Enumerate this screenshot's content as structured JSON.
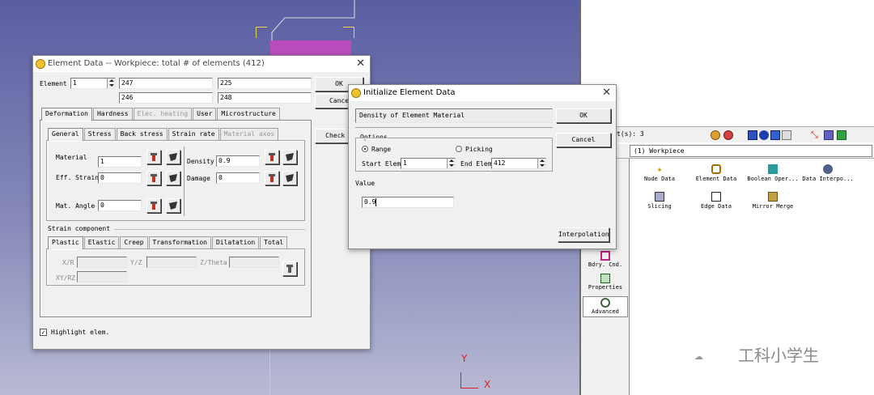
{
  "viewport": {
    "axis_y": "Y",
    "axis_x": "X"
  },
  "element_dialog": {
    "title": "Element Data -- Workpiece: total # of elements (412)",
    "element_label": "Element",
    "element_value": "1",
    "neighbors": [
      "247",
      "225",
      "246",
      "248"
    ],
    "ok_label": "OK",
    "cancel_label": "Cance",
    "check_label": "Check M",
    "main_tabs": [
      "Deformation",
      "Hardness",
      "Elec. heating",
      "User",
      "Microstructure"
    ],
    "sub_tabs": [
      "General",
      "Stress",
      "Back stress",
      "Strain rate",
      "Material axes"
    ],
    "material_label": "Material",
    "material_value": "1",
    "eff_strain_label": "Eff. Strain",
    "eff_strain_value": "0",
    "density_label": "Density",
    "density_value": "0.9",
    "damage_label": "Damage",
    "damage_value": "0",
    "mat_angle_label": "Mat. Angle",
    "mat_angle_value": "0",
    "strain_component_label": "Strain component",
    "strain_tabs": [
      "Plastic",
      "Elastic",
      "Creep",
      "Transformation",
      "Dilatation",
      "Total"
    ],
    "xr_label": "X/R",
    "yz_label": "Y/Z",
    "ztheta_label": "Z/Theta",
    "xyrz_label": "XY/RZ",
    "highlight_label": "Highlight elem."
  },
  "init_dialog": {
    "title": "Initialize Element Data",
    "field_name": "Density of Element Material",
    "ok_label": "OK",
    "cancel_label": "Cancel",
    "options_label": "Options",
    "range_label": "Range",
    "picking_label": "Picking",
    "start_elem_label": "Start Elem",
    "start_elem_value": "1",
    "end_elem_label": "End Elem",
    "end_elem_value": "412",
    "value_label": "Value",
    "value_value": "0.9",
    "interpolation_label": "Interpolation"
  },
  "right_panel": {
    "object_count": "t(s): 3",
    "object_item": "(1) Workpiece",
    "tools": [
      {
        "label": "Node Data",
        "icon": "node-data-icon"
      },
      {
        "label": "Element Data",
        "icon": "element-data-icon"
      },
      {
        "label": "Boolean Oper...",
        "icon": "boolean-icon"
      },
      {
        "label": "Data Interpo...",
        "icon": "data-interp-icon"
      },
      {
        "label": "Slicing",
        "icon": "slicing-icon"
      },
      {
        "label": "Edge Data",
        "icon": "edge-data-icon"
      },
      {
        "label": "Mirror Merge",
        "icon": "mirror-merge-icon"
      }
    ],
    "side_items": [
      "Bdry. Cnd.",
      "Properties",
      "Advanced"
    ]
  },
  "watermark": "工科小学生"
}
